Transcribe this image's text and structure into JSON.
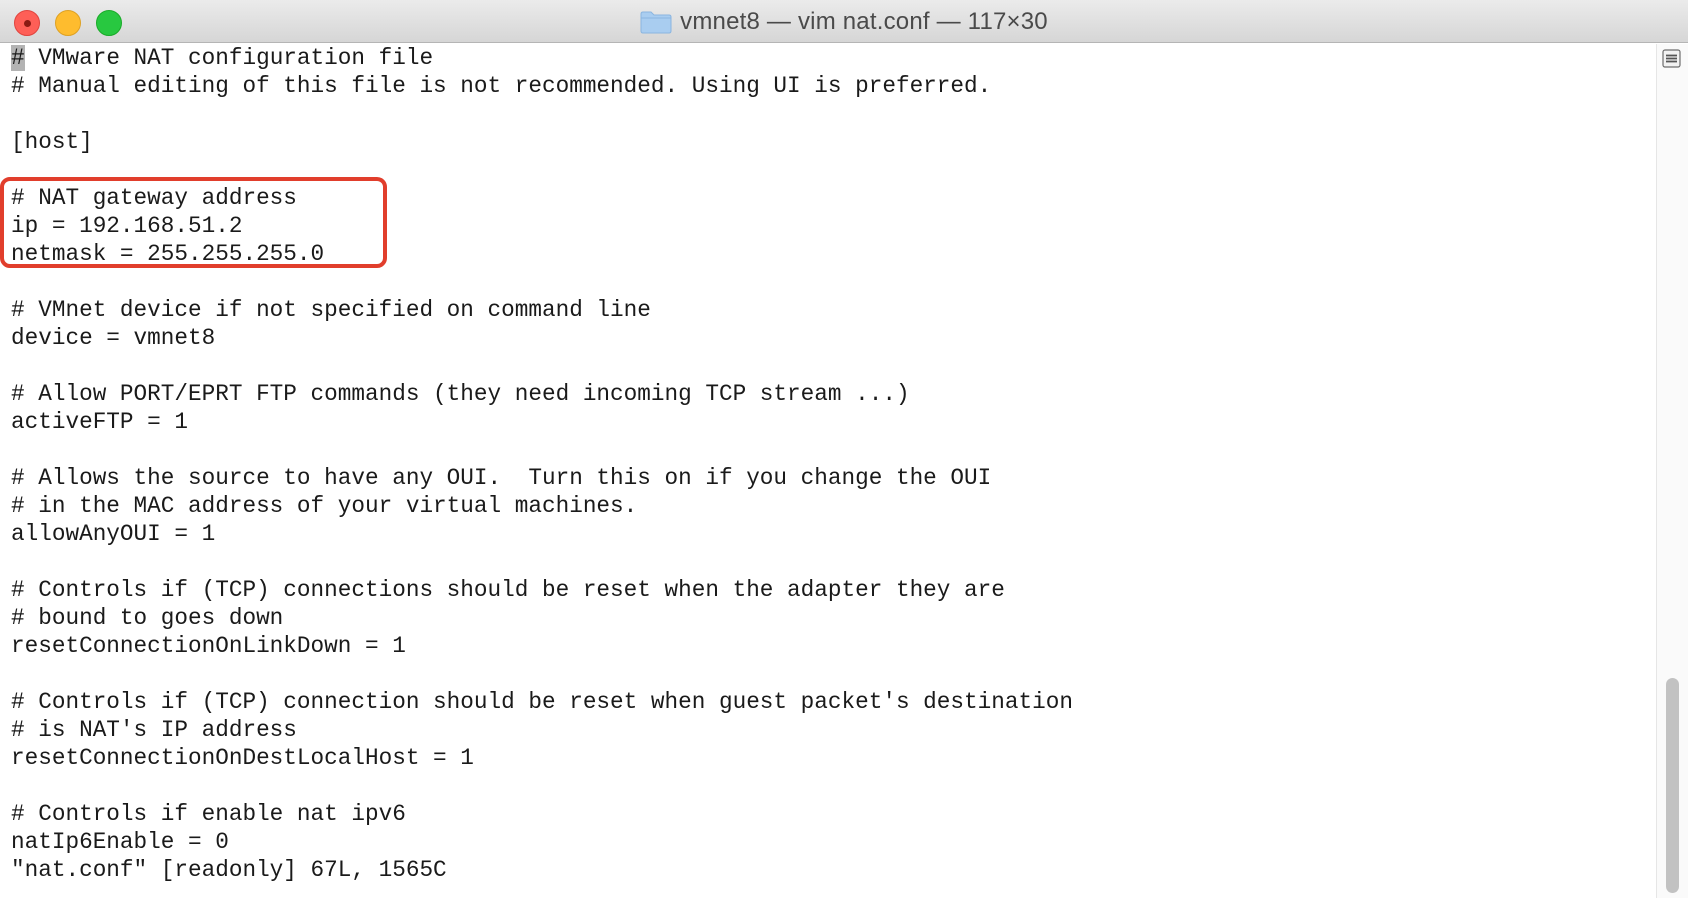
{
  "window": {
    "title": "vmnet8 — vim nat.conf — 117×30",
    "folder_icon": "folder-icon",
    "buttons": {
      "close": "close-button",
      "minimize": "minimize-button",
      "maximize": "maximize-button"
    }
  },
  "editor": {
    "cursor_char": "#",
    "lines": [
      " VMware NAT configuration file",
      "# Manual editing of this file is not recommended. Using UI is preferred.",
      "",
      "[host]",
      "",
      "# NAT gateway address",
      "ip = 192.168.51.2",
      "netmask = 255.255.255.0",
      "",
      "# VMnet device if not specified on command line",
      "device = vmnet8",
      "",
      "# Allow PORT/EPRT FTP commands (they need incoming TCP stream ...)",
      "activeFTP = 1",
      "",
      "# Allows the source to have any OUI.  Turn this on if you change the OUI",
      "# in the MAC address of your virtual machines.",
      "allowAnyOUI = 1",
      "",
      "# Controls if (TCP) connections should be reset when the adapter they are",
      "# bound to goes down",
      "resetConnectionOnLinkDown = 1",
      "",
      "# Controls if (TCP) connection should be reset when guest packet's destination",
      "# is NAT's IP address",
      "resetConnectionOnDestLocalHost = 1",
      "",
      "# Controls if enable nat ipv6",
      "natIp6Enable = 0"
    ],
    "status_line": "\"nat.conf\" [readonly] 67L, 1565C"
  },
  "annotation": {
    "color": "#e13e2c"
  }
}
